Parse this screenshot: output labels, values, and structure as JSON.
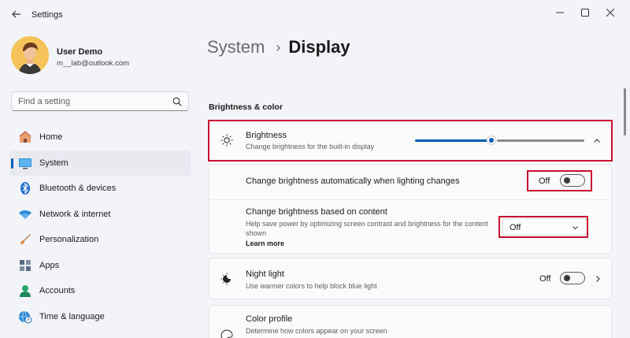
{
  "window": {
    "title": "Settings"
  },
  "user": {
    "name": "User Demo",
    "email": "m__lab@outlook.com"
  },
  "search": {
    "placeholder": "Find a setting"
  },
  "nav": [
    {
      "label": "Home",
      "icon": "home-icon"
    },
    {
      "label": "System",
      "icon": "system-icon",
      "active": true
    },
    {
      "label": "Bluetooth & devices",
      "icon": "bluetooth-icon"
    },
    {
      "label": "Network & internet",
      "icon": "wifi-icon"
    },
    {
      "label": "Personalization",
      "icon": "brush-icon"
    },
    {
      "label": "Apps",
      "icon": "apps-icon"
    },
    {
      "label": "Accounts",
      "icon": "accounts-icon"
    },
    {
      "label": "Time & language",
      "icon": "globe-clock-icon"
    }
  ],
  "breadcrumb": {
    "parent": "System",
    "separator": "›",
    "current": "Display"
  },
  "section": {
    "title": "Brightness & color"
  },
  "brightness": {
    "title": "Brightness",
    "desc": "Change brightness for the built-in display",
    "level": 0.47
  },
  "auto_brightness": {
    "label": "Change brightness automatically when lighting changes",
    "toggle_state": "Off"
  },
  "content_brightness": {
    "title": "Change brightness based on content",
    "desc": "Help save power by optimizing screen contrast and brightness for the content shown",
    "link": "Learn more",
    "dropdown_value": "Off"
  },
  "night_light": {
    "title": "Night light",
    "desc": "Use warmer colors to help block blue light",
    "toggle_state": "Off"
  },
  "color_profile": {
    "title": "Color profile",
    "desc": "Determine how colors appear on your screen"
  },
  "colors": {
    "accent": "#005fb8",
    "highlight": "#c8102e"
  }
}
